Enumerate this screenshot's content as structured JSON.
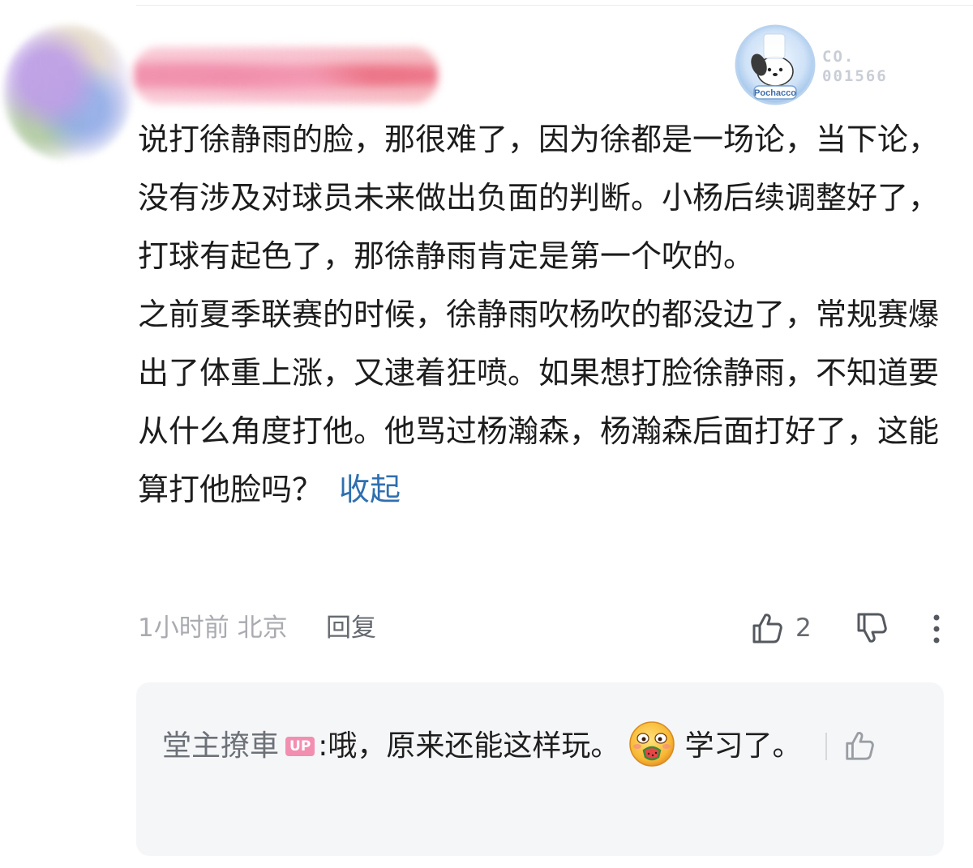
{
  "comment": {
    "badge": {
      "name": "Pochacco",
      "number_line1": "CO.",
      "number_line2": "001566"
    },
    "paragraphs": [
      "说打徐静雨的脸，那很难了，因为徐都是一场论，当下论，没有涉及对球员未来做出负面的判断。小杨后续调整好了，打球有起色了，那徐静雨肯定是第一个吹的。",
      "之前夏季联赛的时候，徐静雨吹杨吹的都没边了，常规赛爆出了体重上涨，又逮着狂喷。如果想打脸徐静雨，不知道要从什么角度打他。他骂过杨瀚森，杨瀚森后面打好了，这能算打他脸吗？"
    ],
    "collapse_label": "收起",
    "time_location": "1小时前 北京",
    "reply_label": "回复",
    "like_count": "2"
  },
  "reply": {
    "author": "堂主撩車",
    "up_tag": "UP",
    "separator": ":",
    "text_before_emoji": "哦，原来还能这样玩。",
    "text_after_emoji": "学习了。"
  },
  "icons": {
    "like": "thumbs-up-icon",
    "dislike": "thumbs-down-icon",
    "more": "more-vertical-icon",
    "emoji": "eating-watermelon-emoji"
  }
}
